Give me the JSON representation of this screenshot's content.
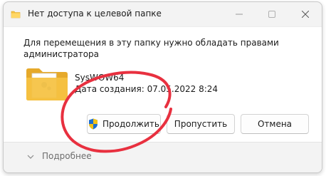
{
  "dialog": {
    "title": "Нет доступа к целевой папке",
    "message": "Для перемещения в эту папку нужно обладать правами администратора",
    "item": {
      "name": "SysWOW64",
      "date_created": "Дата создания: 07.05.2022 8:24"
    },
    "buttons": {
      "continue_label": "Продолжить",
      "skip_label": "Пропустить",
      "cancel_label": "Отмена"
    },
    "more_details_label": "Подробнее"
  },
  "colors": {
    "folder": "#f5c242",
    "annotation": "#e8303f",
    "shield_blue": "#1f6fd1",
    "shield_yellow": "#f3c318"
  },
  "icons": {
    "title": "folder-icon",
    "file": "folder-icon",
    "button": "uac-shield-icon",
    "expand": "chevron-down-icon"
  }
}
